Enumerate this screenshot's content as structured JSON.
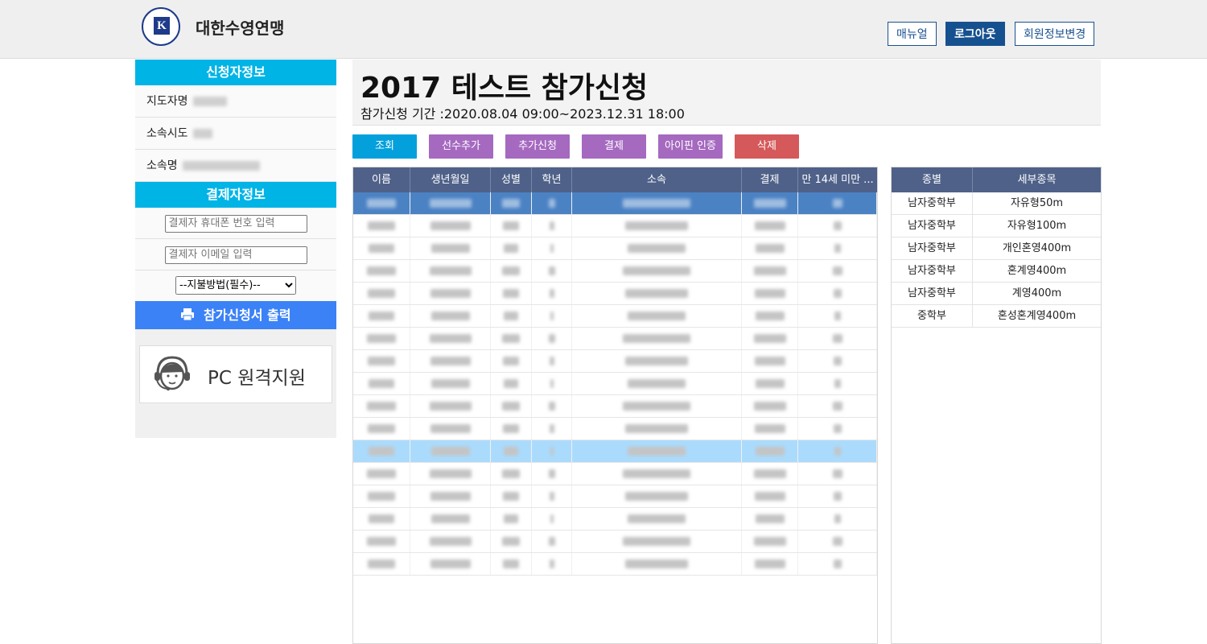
{
  "header": {
    "org_name": "대한수영연맹",
    "logo_letter": "K",
    "buttons": {
      "manual": "매뉴얼",
      "logout": "로그아웃",
      "edit_member": "회원정보변경"
    }
  },
  "sidebar": {
    "applicant_header": "신청자정보",
    "applicant_fields": [
      {
        "label": "지도자명"
      },
      {
        "label": "소속시도"
      },
      {
        "label": "소속명"
      }
    ],
    "payer_header": "결제자정보",
    "phone_placeholder": "결제자 휴대폰 번호 입력",
    "email_placeholder": "결제자 이메일 입력",
    "payment_select": "--지불방법(필수)--",
    "print_button": "참가신청서 출력",
    "pc_support": "PC 원격지원"
  },
  "main": {
    "title": "2017 테스트 참가신청",
    "period": "참가신청 기간 :2020.08.04 09:00~2023.12.31 18:00",
    "actions": {
      "search": "조회",
      "add_player": "선수추가",
      "extra_apply": "추가신청",
      "payment": "결제",
      "ipin": "아이핀 인증",
      "delete": "삭제"
    },
    "colors": {
      "search": "#03a0dc",
      "purple": "#a569c0",
      "delete": "#d5595a",
      "header": "#4f6189",
      "selected_row": "#4b82c4",
      "highlight_row": "#abdbfc"
    },
    "player_table": {
      "headers": [
        "이름",
        "생년월일",
        "성별",
        "학년",
        "소속",
        "결제",
        "만 14세 미만 ..."
      ],
      "row_count": 17,
      "selected_row": 0,
      "highlight_row": 11
    },
    "event_table": {
      "headers": [
        "종별",
        "세부종목"
      ],
      "rows": [
        [
          "남자중학부",
          "자유형50m"
        ],
        [
          "남자중학부",
          "자유형100m"
        ],
        [
          "남자중학부",
          "개인혼영400m"
        ],
        [
          "남자중학부",
          "혼계영400m"
        ],
        [
          "남자중학부",
          "계영400m"
        ],
        [
          "중학부",
          "혼성혼계영400m"
        ]
      ]
    }
  }
}
